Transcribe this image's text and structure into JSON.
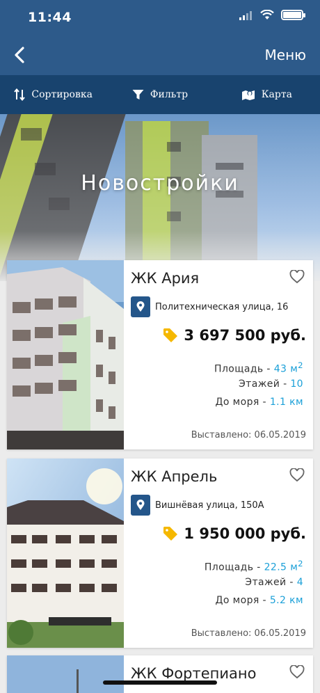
{
  "status": {
    "time": "11:44"
  },
  "nav": {
    "back_icon": "chevron-left-icon",
    "menu_label": "Меню"
  },
  "toolbar": {
    "sort": {
      "label": "Сортировка",
      "icon": "sort-arrows-icon"
    },
    "filter": {
      "label": "Фильтр",
      "icon": "funnel-icon"
    },
    "map": {
      "label": "Карта",
      "icon": "map-pin-icon"
    }
  },
  "hero": {
    "title": "Новостройки"
  },
  "listings": [
    {
      "name": "ЖК Ария",
      "address": "Политехническая улица, 16",
      "price": "3 697 500 руб.",
      "area_label": "Площадь",
      "area_value": "43 м",
      "area_sup": "2",
      "floors_label": "Этажей",
      "floors_value": "10",
      "sea_label": "До моря",
      "sea_value": "1.1 км",
      "listed": "Выставлено: 06.05.2019"
    },
    {
      "name": "ЖК Апрель",
      "address": "Вишнёвая улица, 150А",
      "price": "1 950 000 руб.",
      "area_label": "Площадь",
      "area_value": "22.5 м",
      "area_sup": "2",
      "floors_label": "Этажей",
      "floors_value": "4",
      "sea_label": "До моря",
      "sea_value": "5.2 км",
      "listed": "Выставлено: 06.05.2019"
    },
    {
      "name": "ЖК Фортепиано"
    }
  ],
  "colors": {
    "header": "#2d5a8a",
    "toolbar": "#18436e",
    "accent": "#1ba0d8",
    "price_tag": "#f5b800",
    "pin": "#24568a"
  }
}
